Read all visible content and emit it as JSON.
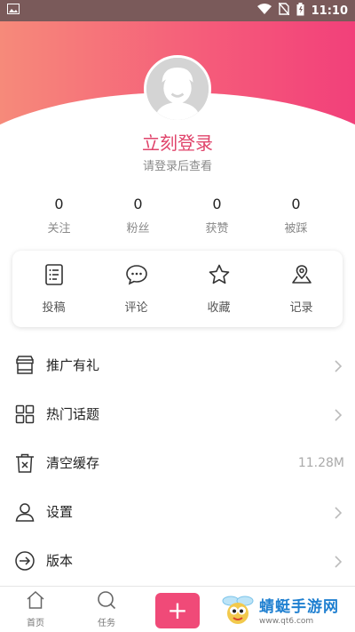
{
  "status_bar": {
    "time": "11:10"
  },
  "profile": {
    "login_title": "立刻登录",
    "login_subtitle": "请登录后查看"
  },
  "stats": [
    {
      "value": "0",
      "label": "关注"
    },
    {
      "value": "0",
      "label": "粉丝"
    },
    {
      "value": "0",
      "label": "获赞"
    },
    {
      "value": "0",
      "label": "被踩"
    }
  ],
  "actions": [
    {
      "label": "投稿",
      "icon": "document-list-icon"
    },
    {
      "label": "评论",
      "icon": "chat-bubble-icon"
    },
    {
      "label": "收藏",
      "icon": "star-icon"
    },
    {
      "label": "记录",
      "icon": "map-pin-icon"
    }
  ],
  "menu": [
    {
      "label": "推广有礼",
      "icon": "shop-icon",
      "value": ""
    },
    {
      "label": "热门话题",
      "icon": "grid-icon",
      "value": ""
    },
    {
      "label": "清空缓存",
      "icon": "trash-icon",
      "value": "11.28M"
    },
    {
      "label": "设置",
      "icon": "user-icon",
      "value": ""
    },
    {
      "label": "版本",
      "icon": "arrow-circle-icon",
      "value": ""
    }
  ],
  "bottom_nav": [
    {
      "label": "首页",
      "icon": "home-icon"
    },
    {
      "label": "任务",
      "icon": "search-icon"
    },
    {
      "label": "",
      "icon": "plus-icon"
    }
  ],
  "watermark": {
    "title": "蜻蜓手游网",
    "url": "www.qt6.com"
  },
  "colors": {
    "accent": "#e0446b",
    "gradient_start": "#f68a7a",
    "gradient_end": "#f2407a"
  }
}
